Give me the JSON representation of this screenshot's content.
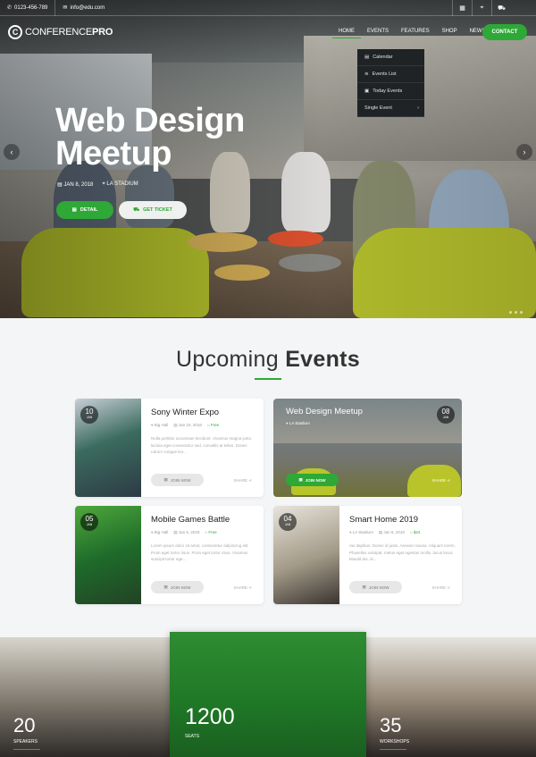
{
  "topbar": {
    "phone": "0123-456-789",
    "email": "info@edu.com"
  },
  "logo": {
    "mark": "C",
    "name_light": "CONFERENCE",
    "name_bold": "PRO"
  },
  "nav": {
    "items": [
      "HOME",
      "EVENTS",
      "FEATURES",
      "SHOP",
      "NEWS"
    ],
    "contact": "CONTACT"
  },
  "dropdown": {
    "items": [
      "Calendar",
      "Events List",
      "Today Events",
      "Single Event"
    ]
  },
  "hero": {
    "title_line1": "Web Design",
    "title_line2": "Meetup",
    "date": "JAN 8, 2018",
    "location": "LA STADIUM",
    "detail_label": "DETAIL",
    "ticket_label": "GET TICKET"
  },
  "section": {
    "title_light": "Upcoming",
    "title_bold": "Events"
  },
  "events": [
    {
      "title": "Sony Winter Expo",
      "day": "10",
      "month": "JAN",
      "venue": "Big Hall",
      "date": "Jan 10, 2018",
      "price": "Free",
      "desc": "Nulla porttitor accumsan tincidunt. Vivamus magna justo, lacinia eget consectetur sed, convallis at tellus. Donec rutrum congue leo...",
      "join": "JOIN NOW",
      "share": "SHARE"
    },
    {
      "title": "Web Design Meetup",
      "day": "08",
      "month": "JAN",
      "venue": "LA Stadium",
      "join": "JOIN NOW",
      "share": "SHARE"
    },
    {
      "title": "Mobile Games Battle",
      "day": "05",
      "month": "JAN",
      "venue": "Big Hall",
      "date": "Jan 5, 2018",
      "price": "Free",
      "desc": "Lorem ipsum dolor sit amet, consectetur adipiscing elit. Proin eget tortor risus. Proin eget tortor risus. Vivamus suscipit tortor ege...",
      "join": "JOIN NOW",
      "share": "SHARE"
    },
    {
      "title": "Smart Home 2019",
      "day": "04",
      "month": "JAN",
      "venue": "LA Stadium",
      "date": "Jan 6, 2018",
      "price": "$24",
      "desc": "ras dapibus. Donec id justo. Aenean massa. Aliquam lorem. Phasellus volutpat, metus eget egestas mollis, lacus lacus blandit dui, id...",
      "join": "JOIN NOW",
      "share": "SHARE"
    }
  ],
  "stats": [
    {
      "value": "20",
      "label": "SPEAKERS"
    },
    {
      "value": "1200",
      "label": "SEATS"
    },
    {
      "value": "35",
      "label": "WORKSHOPS"
    }
  ],
  "colors": {
    "accent": "#2ea836",
    "dark": "#1f2325"
  }
}
